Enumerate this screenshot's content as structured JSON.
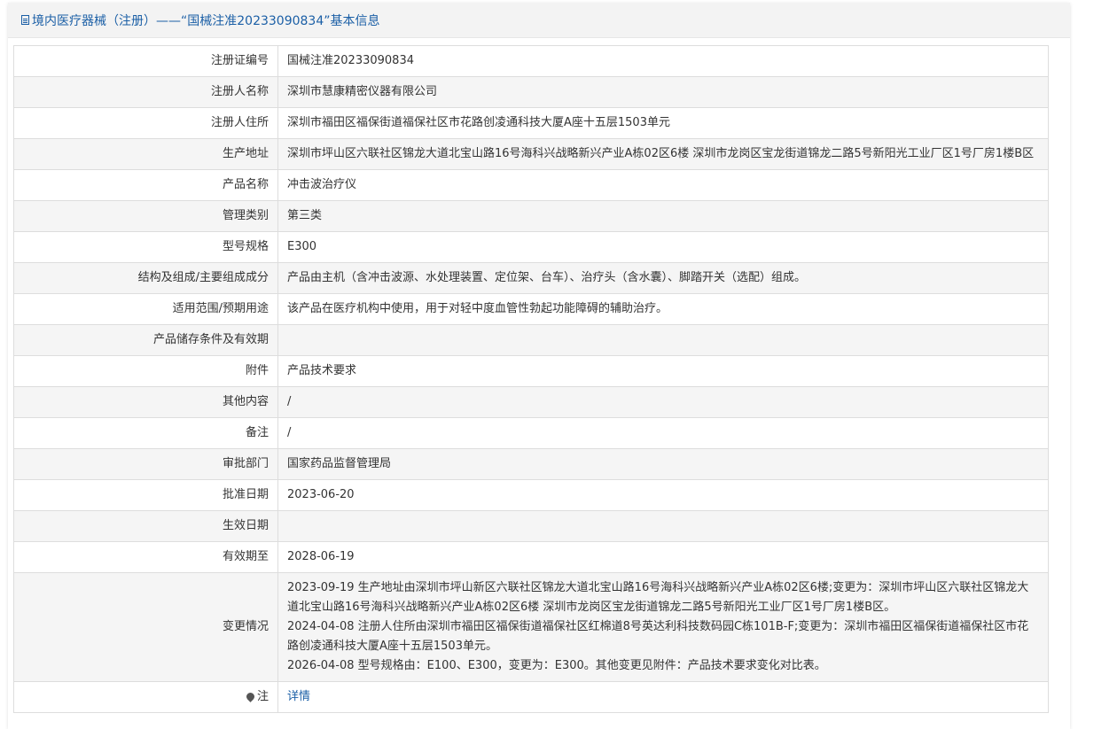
{
  "header": {
    "title": "境内医疗器械（注册）——“国械注准20233090834”基本信息"
  },
  "rows": [
    {
      "label": "注册证编号",
      "value": "国械注准20233090834"
    },
    {
      "label": "注册人名称",
      "value": "深圳市慧康精密仪器有限公司"
    },
    {
      "label": "注册人住所",
      "value": "深圳市福田区福保街道福保社区市花路创凌通科技大厦A座十五层1503单元"
    },
    {
      "label": "生产地址",
      "value": "深圳市坪山区六联社区锦龙大道北宝山路16号海科兴战略新兴产业A栋02区6楼 深圳市龙岗区宝龙街道锦龙二路5号新阳光工业厂区1号厂房1楼B区"
    },
    {
      "label": "产品名称",
      "value": "冲击波治疗仪"
    },
    {
      "label": "管理类别",
      "value": "第三类"
    },
    {
      "label": "型号规格",
      "value": "E300"
    },
    {
      "label": "结构及组成/主要组成成分",
      "value": "产品由主机（含冲击波源、水处理装置、定位架、台车）、治疗头（含水囊）、脚踏开关（选配）组成。"
    },
    {
      "label": "适用范围/预期用途",
      "value": "该产品在医疗机构中使用，用于对轻中度血管性勃起功能障碍的辅助治疗。"
    },
    {
      "label": "产品储存条件及有效期",
      "value": ""
    },
    {
      "label": "附件",
      "value": "产品技术要求"
    },
    {
      "label": "其他内容",
      "value": "/"
    },
    {
      "label": "备注",
      "value": "/"
    },
    {
      "label": "审批部门",
      "value": "国家药品监督管理局"
    },
    {
      "label": "批准日期",
      "value": "2023-06-20"
    },
    {
      "label": "生效日期",
      "value": ""
    },
    {
      "label": "有效期至",
      "value": "2028-06-19"
    }
  ],
  "changes": {
    "label": "变更情况",
    "items": [
      "2023-09-19 生产地址由深圳市坪山新区六联社区锦龙大道北宝山路16号海科兴战略新兴产业A栋02区6楼;变更为：深圳市坪山区六联社区锦龙大道北宝山路16号海科兴战略新兴产业A栋02区6楼 深圳市龙岗区宝龙街道锦龙二路5号新阳光工业厂区1号厂房1楼B区。",
      "2024-04-08 注册人住所由深圳市福田区福保街道福保社区红棉道8号英达利科技数码园C栋101B-F;变更为：深圳市福田区福保街道福保社区市花路创凌通科技大厦A座十五层1503单元。",
      "2026-04-08 型号规格由：E100、E300，变更为：E300。其他变更见附件：产品技术要求变化对比表。"
    ]
  },
  "note": {
    "label": "注",
    "icon": "pin-icon",
    "link_text": "详情"
  }
}
